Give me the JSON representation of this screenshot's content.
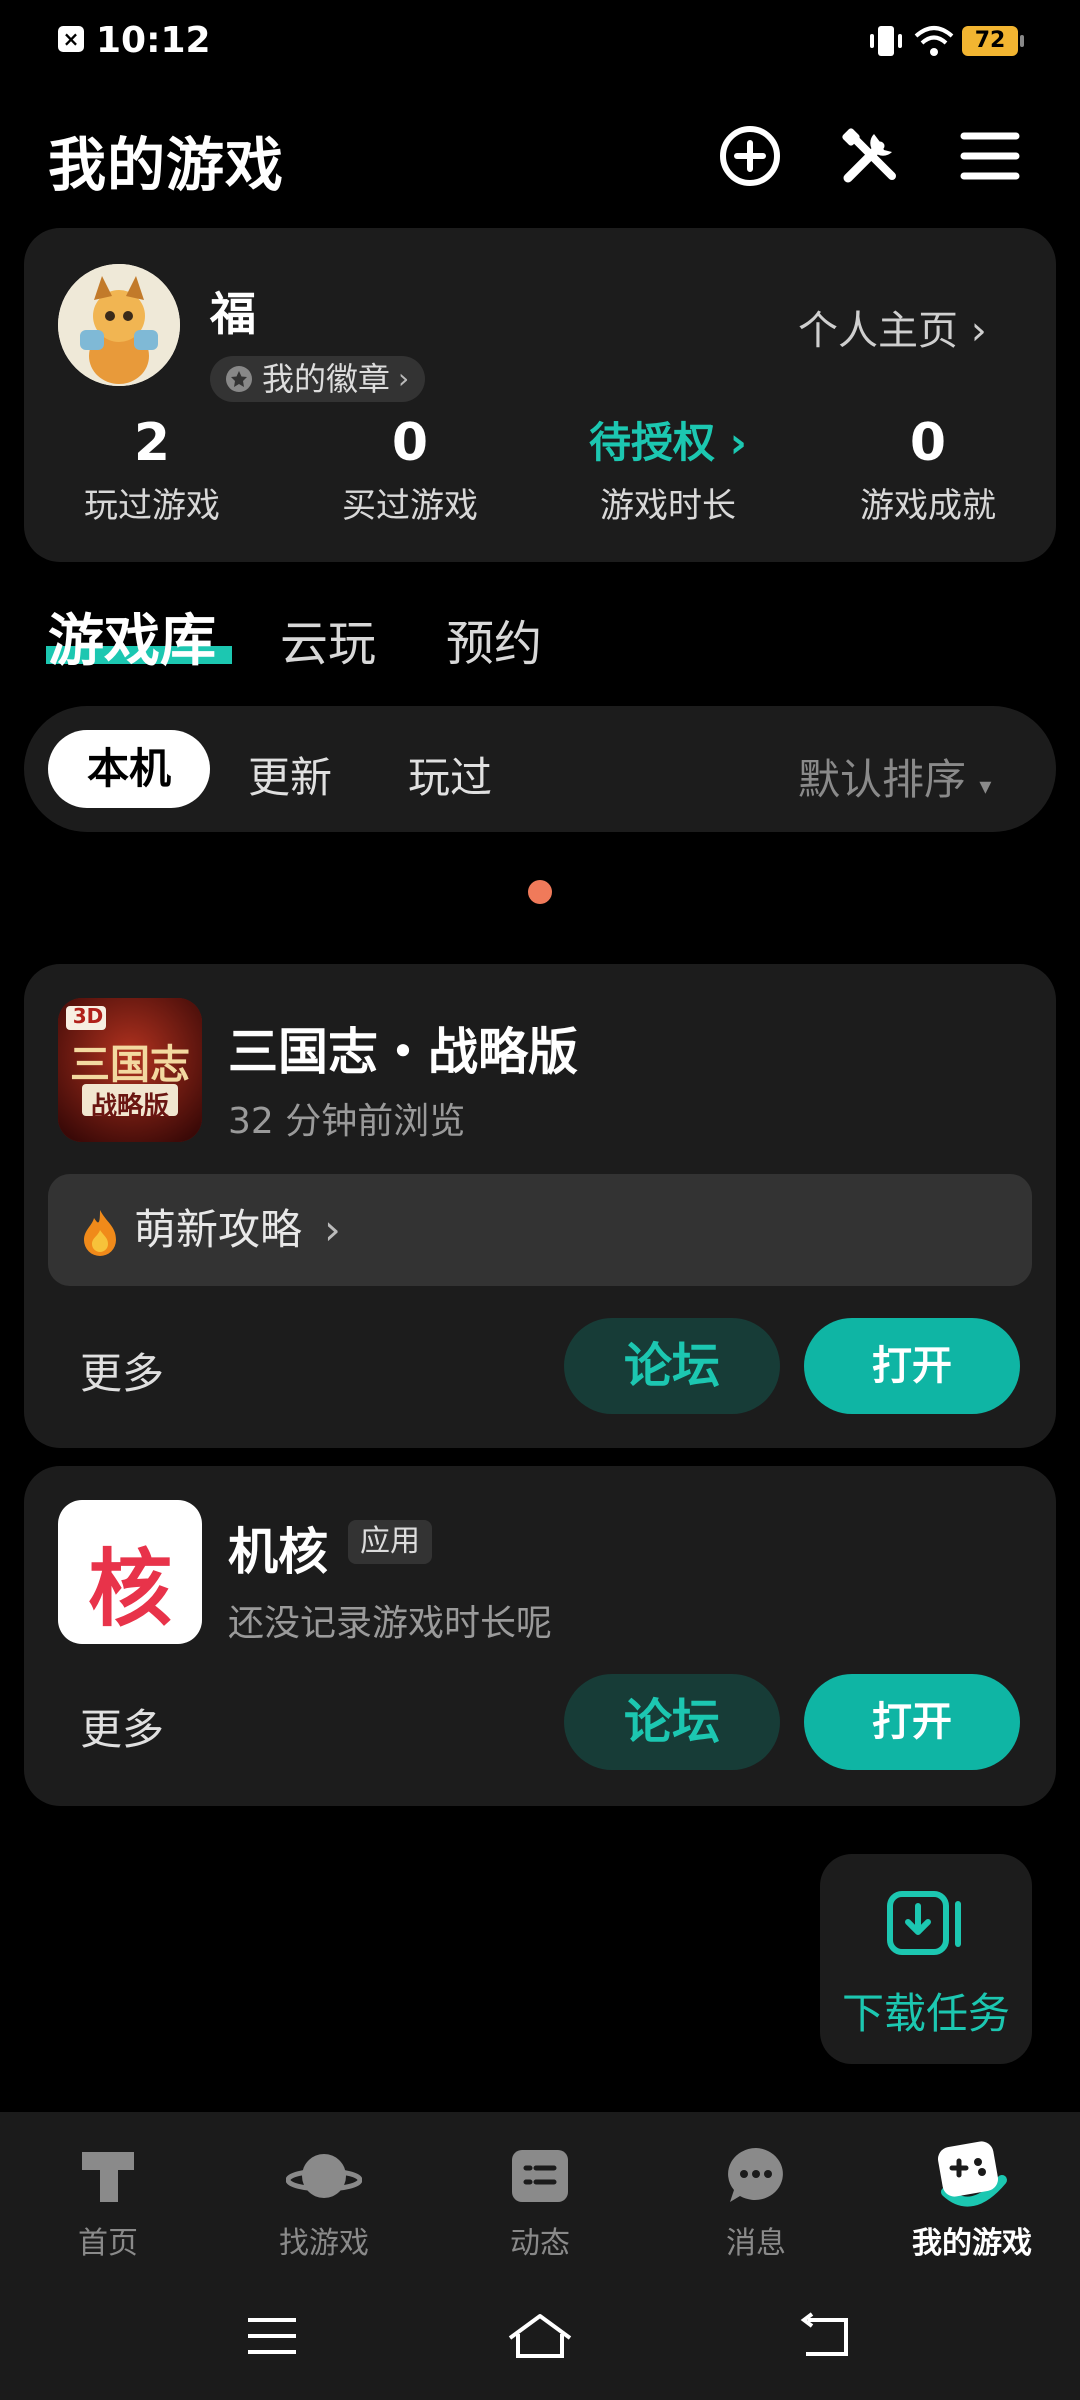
{
  "status_bar": {
    "time": "10:12",
    "battery": "72"
  },
  "header": {
    "title": "我的游戏"
  },
  "profile": {
    "name": "福",
    "badge_label": "我的徽章",
    "homepage_label": "个人主页",
    "stats": [
      {
        "value": "2",
        "label": "玩过游戏"
      },
      {
        "value": "0",
        "label": "买过游戏"
      },
      {
        "value": "待授权",
        "label": "游戏时长"
      },
      {
        "value": "0",
        "label": "游戏成就"
      }
    ]
  },
  "tabs": {
    "library": "游戏库",
    "cloud": "云玩",
    "reserve": "预约"
  },
  "filter": {
    "local": "本机",
    "update": "更新",
    "played": "玩过",
    "sort": "默认排序"
  },
  "games": [
    {
      "title": "三国志・战略版",
      "subtitle": "32 分钟前浏览",
      "icon_text": "三国志",
      "icon_badge": "3D",
      "icon_caption": "战略版",
      "guide": "萌新攻略",
      "more": "更多",
      "forum": "论坛",
      "open": "打开"
    },
    {
      "title": "机核",
      "tag": "应用",
      "subtitle": "还没记录游戏时长呢",
      "icon_text": "核",
      "more": "更多",
      "forum": "论坛",
      "open": "打开"
    }
  ],
  "download_task": {
    "label": "下载任务"
  },
  "bottom_nav": [
    {
      "label": "首页",
      "icon": "home-t-icon"
    },
    {
      "label": "找游戏",
      "icon": "planet-icon"
    },
    {
      "label": "动态",
      "icon": "feed-icon"
    },
    {
      "label": "消息",
      "icon": "chat-icon"
    },
    {
      "label": "我的游戏",
      "icon": "gamepad-icon"
    }
  ],
  "colors": {
    "accent": "#1cc7b1",
    "card": "#1c1c1c",
    "forum_bg": "#173c37"
  }
}
